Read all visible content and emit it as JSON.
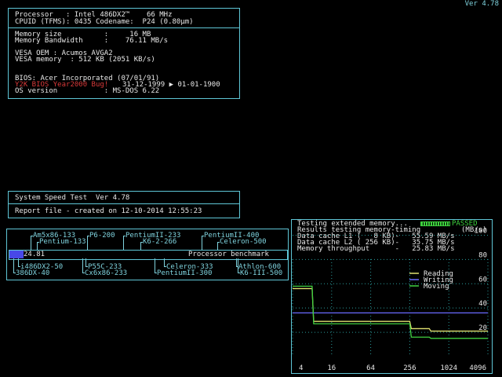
{
  "version": "Ver 4.78",
  "sysinfo": {
    "processor": "Processor   : Intel 486DX2™    66 MHz",
    "cpuid": "CPUID (TFMS): 0435 Codename:  P24 (0.80µm)",
    "memory_size": "Memory size          :     16 MB",
    "memory_bandwidth": "Memory Bandwidth     :    76.11 MB/s",
    "vesa_oem": "VESA OEM : Acumos AVGA2",
    "vesa_memory": "VESA memory  : 512 KB (2051 KB/s)",
    "bios": "BIOS: Acer Incorporated (07/01/91)",
    "y2k_label": "Y2K BIOS Year2000 Bug!",
    "y2k_dates": "31-12-1999 ▶ 01-01-1900",
    "os": "OS version           : MS-DOS 6.22"
  },
  "report": {
    "title": "System Speed Test  Ver 4.78",
    "report_file": "Report file - created on 12-10-2014 12:55:23"
  },
  "benchmark": {
    "top_row1": [
      {
        "label": "Am5x86-133",
        "x": 30
      },
      {
        "label": "P6-200",
        "x": 102
      },
      {
        "label": "PentiumII-233",
        "x": 148
      },
      {
        "label": "PentiumII-400",
        "x": 248
      }
    ],
    "top_row2": [
      {
        "label": "Pentium-133",
        "x": 38
      },
      {
        "label": "K6-2-266",
        "x": 170
      },
      {
        "label": "Celeron-500",
        "x": 268
      }
    ],
    "bottom_row1": [
      {
        "label": "i486DX2-50",
        "x": 14
      },
      {
        "label": "P55C-233",
        "x": 100
      },
      {
        "label": "Celeron-333",
        "x": 200
      },
      {
        "label": "Athlon-600",
        "x": 292
      }
    ],
    "bottom_row2": [
      {
        "label": "386DX-40",
        "x": 8
      },
      {
        "label": "Cx6x86-233",
        "x": 96
      },
      {
        "label": "PentiumII-300",
        "x": 188
      },
      {
        "label": "K6-III-500",
        "x": 294
      }
    ],
    "score": "24.81",
    "score_fraction": 0.05,
    "caption": "Processor benchmark"
  },
  "memtest": {
    "status_text": "Testing extended memory...",
    "status_result": "PASSED",
    "results_label": "Results testing memory-timing",
    "units": "(MB/s)",
    "l1_line": "Data cache L1 (   8 KB)-   55.59 MB/s",
    "l2_line": "Data cache L2 ( 256 KB)-   35.75 MB/s",
    "mem_line": "Memory throughput      -   25.83 MB/s",
    "legend": [
      {
        "name": "Reading",
        "color": "#e0e070"
      },
      {
        "name": "Writing",
        "color": "#6a6aff"
      },
      {
        "name": "Moving",
        "color": "#40d040"
      }
    ]
  },
  "chart_data": {
    "type": "line",
    "x_scale": "log2",
    "x_ticks": [
      "4",
      "16",
      "64",
      "256",
      "1024",
      "4096"
    ],
    "y_ticks": [
      "100",
      "80",
      "60",
      "40",
      "20"
    ],
    "ylim": [
      0,
      110
    ],
    "x": [
      4,
      8,
      16,
      32,
      64,
      128,
      256,
      512,
      1024,
      2048,
      4096
    ],
    "series": [
      {
        "name": "Reading",
        "color": "#e0e070",
        "values": [
          56,
          56,
          29,
          29,
          29,
          29,
          29,
          23,
          21,
          21,
          21
        ]
      },
      {
        "name": "Writing",
        "color": "#6a6aff",
        "values": [
          36,
          36,
          36,
          36,
          36,
          36,
          36,
          36,
          36,
          36,
          36
        ]
      },
      {
        "name": "Moving",
        "color": "#40d040",
        "values": [
          58,
          58,
          27,
          27,
          27,
          27,
          27,
          16,
          15,
          15,
          15
        ]
      }
    ]
  }
}
